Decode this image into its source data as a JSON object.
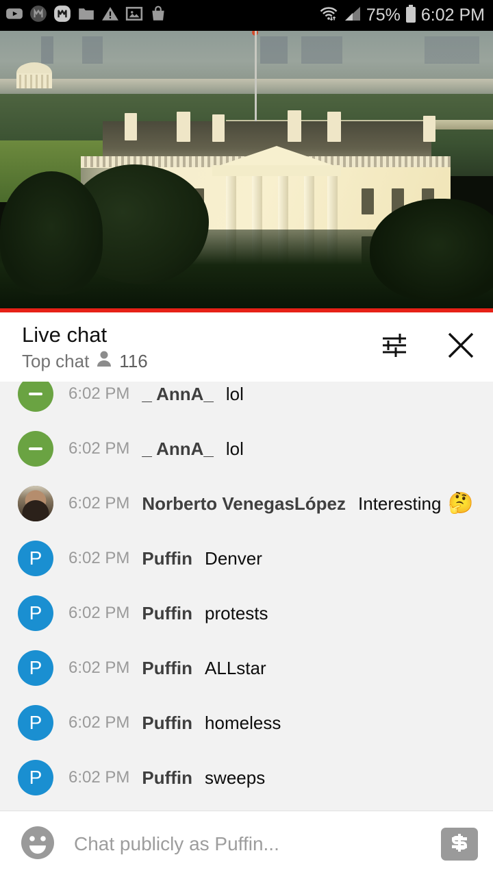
{
  "status_bar": {
    "left_icons": [
      {
        "name": "youtube-icon"
      },
      {
        "name": "music-app-filled-icon"
      },
      {
        "name": "music-app-outline-icon"
      },
      {
        "name": "folder-icon"
      },
      {
        "name": "warning-triangle-icon"
      },
      {
        "name": "image-icon"
      },
      {
        "name": "shopping-bag-icon"
      }
    ],
    "wifi_icon": "wifi-icon",
    "signal_icon": "cellular-signal-icon",
    "battery_percent": "75%",
    "battery_icon": "battery-icon",
    "clock": "6:02 PM"
  },
  "video": {
    "progress_color": "#e62117",
    "progress_percent": 100,
    "scene_description": "White House"
  },
  "chat_header": {
    "title": "Live chat",
    "mode": "Top chat",
    "viewers_icon": "person-icon",
    "viewers": "116",
    "settings_icon": "tune-icon",
    "close_icon": "close-icon"
  },
  "messages": [
    {
      "time": "6:02 PM",
      "author": "_ AnnA_",
      "text": "lol",
      "avatar": {
        "type": "initial-dash",
        "color": "#6aa342",
        "letter": "-"
      },
      "emoji": ""
    },
    {
      "time": "6:02 PM",
      "author": "_ AnnA_",
      "text": "lol",
      "avatar": {
        "type": "initial-dash",
        "color": "#6aa342",
        "letter": "-"
      },
      "emoji": ""
    },
    {
      "time": "6:02 PM",
      "author": "Norberto VenegasLópez",
      "text": "Interesting",
      "avatar": {
        "type": "photo",
        "color": "#6a5c4c",
        "letter": ""
      },
      "emoji": "🤔"
    },
    {
      "time": "6:02 PM",
      "author": "Puffin",
      "text": "Denver",
      "avatar": {
        "type": "initial",
        "color": "#1a8fd1",
        "letter": "P"
      },
      "emoji": ""
    },
    {
      "time": "6:02 PM",
      "author": "Puffin",
      "text": "protests",
      "avatar": {
        "type": "initial",
        "color": "#1a8fd1",
        "letter": "P"
      },
      "emoji": ""
    },
    {
      "time": "6:02 PM",
      "author": "Puffin",
      "text": "ALLstar",
      "avatar": {
        "type": "initial",
        "color": "#1a8fd1",
        "letter": "P"
      },
      "emoji": ""
    },
    {
      "time": "6:02 PM",
      "author": "Puffin",
      "text": "homeless",
      "avatar": {
        "type": "initial",
        "color": "#1a8fd1",
        "letter": "P"
      },
      "emoji": ""
    },
    {
      "time": "6:02 PM",
      "author": "Puffin",
      "text": "sweeps",
      "avatar": {
        "type": "initial",
        "color": "#1a8fd1",
        "letter": "P"
      },
      "emoji": ""
    }
  ],
  "input_bar": {
    "emoji_icon": "emoji-smiley-icon",
    "placeholder": "Chat publicly as Puffin...",
    "value": "",
    "superchat_icon": "dollar-icon"
  },
  "colors": {
    "accent_red": "#e62117",
    "chat_bg": "#f2f2f2",
    "header_bg": "#ffffff",
    "status_bg": "#000000"
  }
}
